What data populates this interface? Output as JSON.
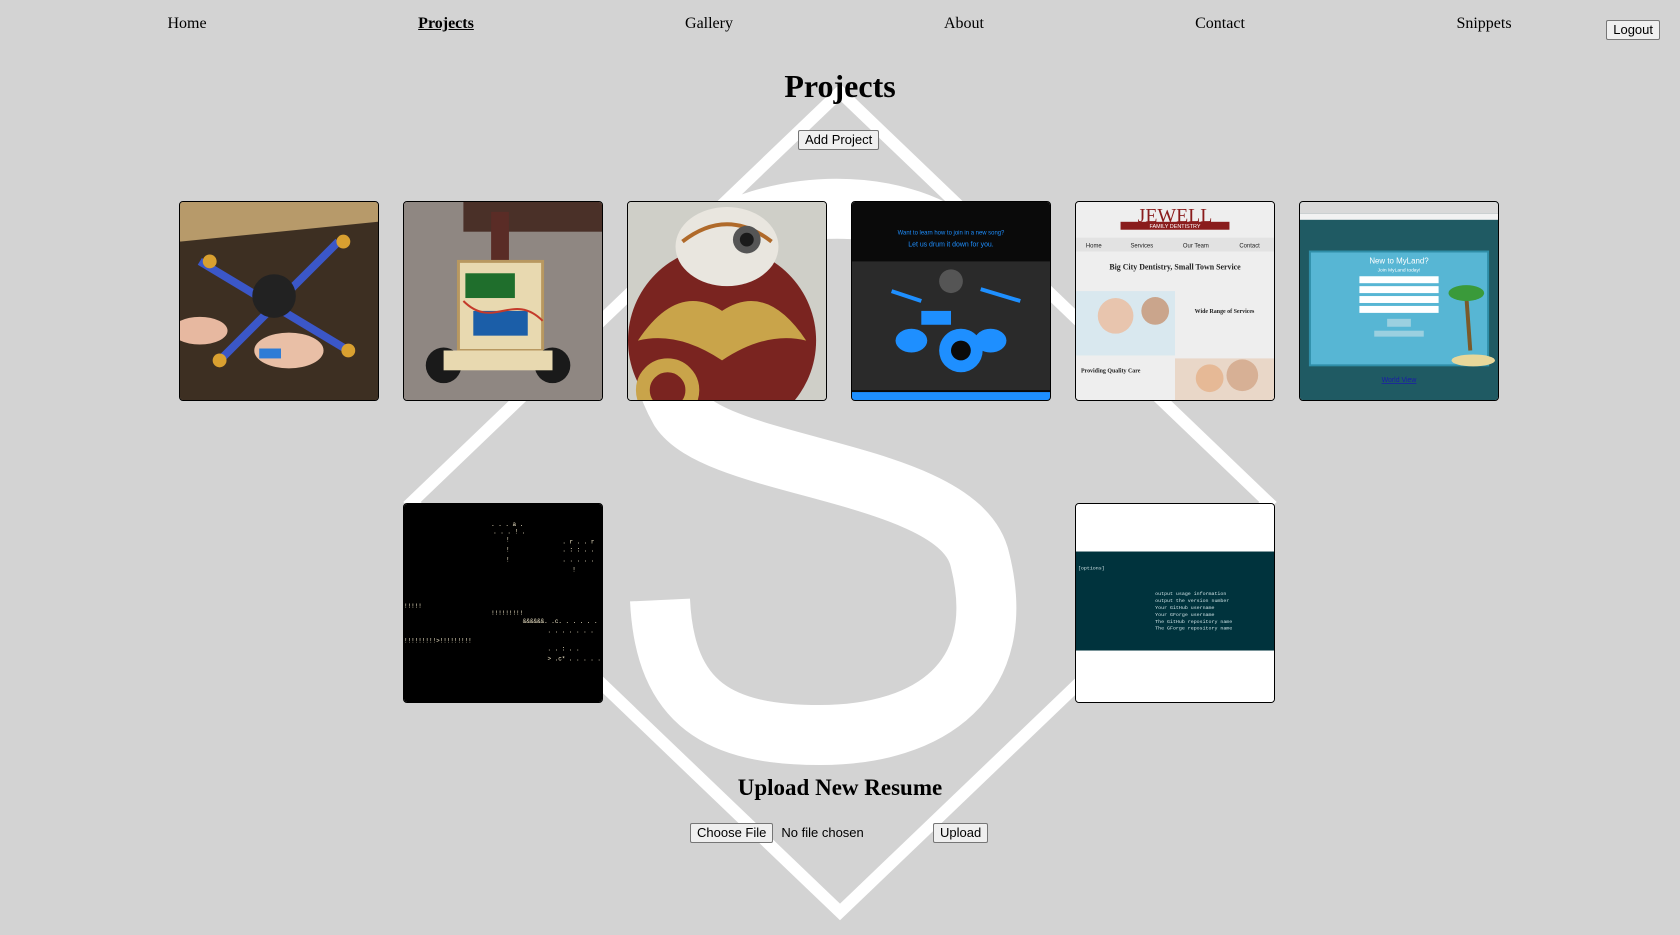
{
  "nav": {
    "items": [
      {
        "label": "Home",
        "active": false
      },
      {
        "label": "Projects",
        "active": true
      },
      {
        "label": "Gallery",
        "active": false
      },
      {
        "label": "About",
        "active": false
      },
      {
        "label": "Contact",
        "active": false
      },
      {
        "label": "Snippets",
        "active": false
      }
    ],
    "logout_label": "Logout"
  },
  "page": {
    "title": "Projects",
    "add_project_label": "Add Project"
  },
  "projects": [
    {
      "thumbnail": "quadcopter-photo"
    },
    {
      "thumbnail": "balancing-robot-photo"
    },
    {
      "thumbnail": "bb8-droid-photo"
    },
    {
      "thumbnail": "drum-website-screenshot",
      "text": [
        "Want to learn how to join in a new song?",
        "Let us drum it down for you."
      ]
    },
    {
      "thumbnail": "dentistry-website-screenshot",
      "text": [
        "JEWELL",
        "FAMILY DENTISTRY",
        "Home",
        "Services",
        "Our Team",
        "Contact",
        "Big City Dentistry, Small Town Service",
        "Wide Range of Services",
        "Providing Quality Care"
      ]
    },
    {
      "thumbnail": "myland-website-screenshot",
      "text": [
        "New to MyLand?",
        "Join MyLand today!",
        "World View"
      ]
    },
    {
      "thumbnail": "ascii-dungeon-screenshot"
    },
    {
      "thumbnail": "cli-help-screenshot",
      "text": [
        "[options]",
        "output usage information",
        "output the version number",
        "Your GitHub username",
        "Your GForge username",
        "The GitHub repository name",
        "The GForge repository name"
      ]
    }
  ],
  "resume": {
    "title": "Upload New Resume",
    "choose_file_label": "Choose File",
    "file_status": "No file chosen",
    "upload_label": "Upload"
  },
  "colors": {
    "background": "#d3d3d3",
    "logo": "#ffffff",
    "drum_blue": "#1e8fff",
    "myland_teal": "#1f5a63",
    "terminal_teal": "#00333d"
  }
}
